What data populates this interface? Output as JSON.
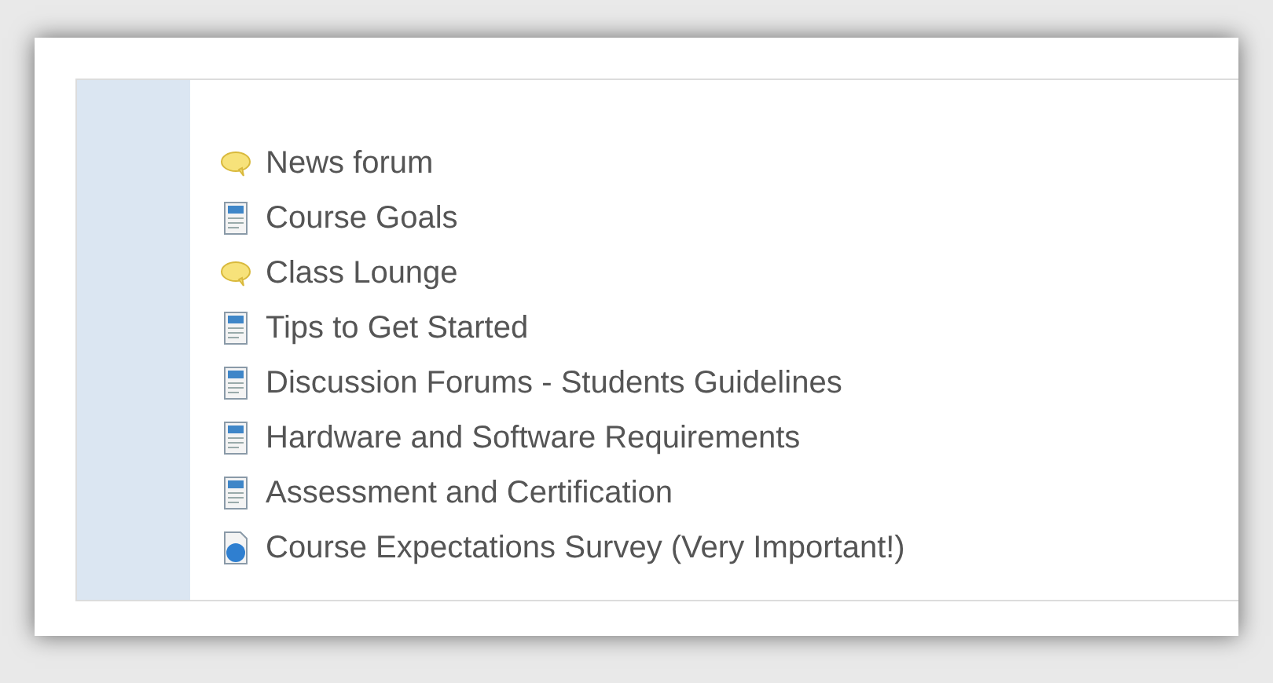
{
  "activities": [
    {
      "kind": "forum",
      "label": "News forum"
    },
    {
      "kind": "page",
      "label": "Course Goals"
    },
    {
      "kind": "forum",
      "label": "Class Lounge"
    },
    {
      "kind": "page",
      "label": "Tips to Get Started"
    },
    {
      "kind": "page",
      "label": "Discussion Forums - Students Guidelines"
    },
    {
      "kind": "page",
      "label": "Hardware and Software Requirements"
    },
    {
      "kind": "page",
      "label": "Assessment and Certification"
    },
    {
      "kind": "survey",
      "label": "Course Expectations Survey (Very Important!)"
    }
  ]
}
